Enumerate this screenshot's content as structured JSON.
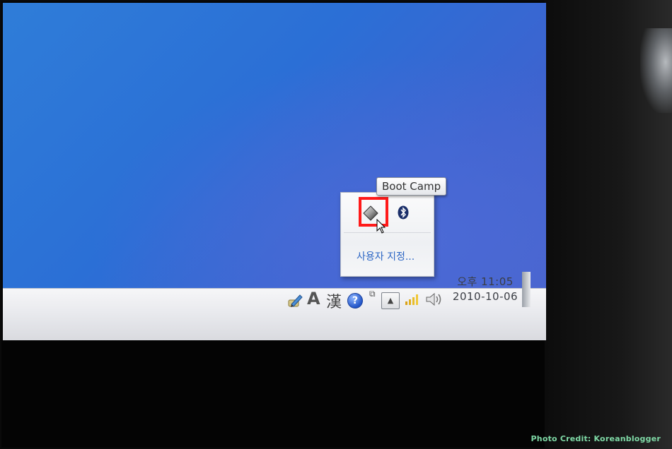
{
  "tooltip": {
    "text": "Boot Camp"
  },
  "flyout": {
    "icons": [
      {
        "name": "bootcamp-icon",
        "label": "Boot Camp"
      },
      {
        "name": "bluetooth-icon"
      }
    ],
    "customize_link": "사용자 지정..."
  },
  "taskbar": {
    "ime": {
      "mode_a": "A",
      "hanja": "漢"
    },
    "help_glyph": "?",
    "show_hidden_glyph": "▲",
    "restore_glyph": "⧉",
    "clock": {
      "time": "오후 11:05",
      "date": "2010-10-06"
    }
  },
  "credit": "Photo Credit: Koreanblogger",
  "colors": {
    "highlight": "#ff1a1a",
    "link": "#2c66c4",
    "desktop": "#2f6fd6"
  }
}
